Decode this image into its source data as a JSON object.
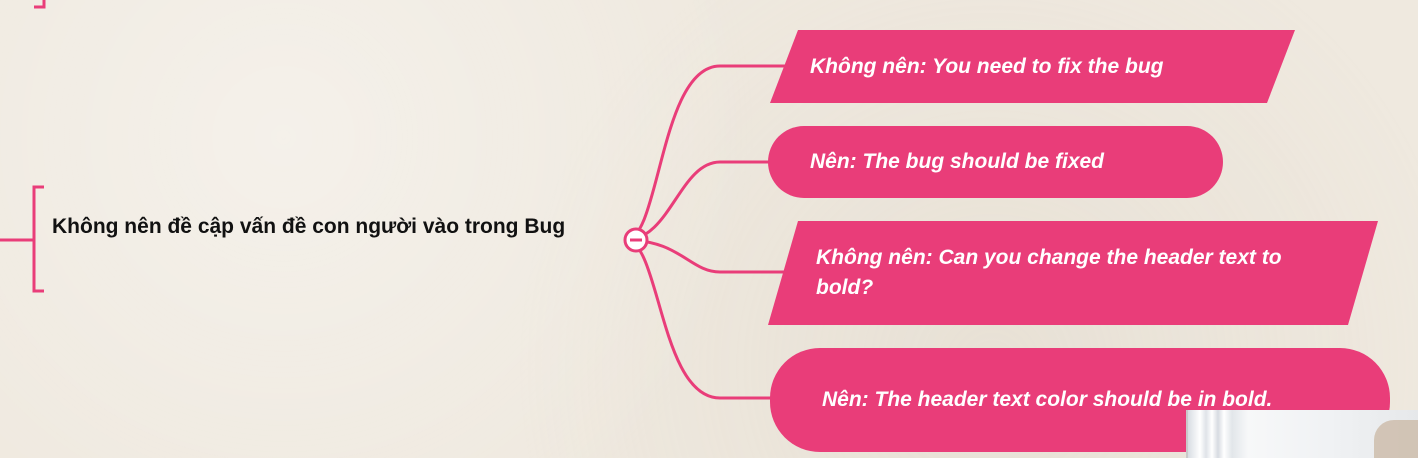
{
  "colors": {
    "accent": "#e93d79",
    "background": "#efe9df",
    "text": "#111111"
  },
  "main_topic": {
    "label": "Không nên đề cập vấn đề con người vào trong Bug"
  },
  "collapse_toggle": {
    "icon": "minus-circle-icon"
  },
  "children": [
    {
      "label": "Không nên: You need to fix the bug",
      "shape": "parallelogram"
    },
    {
      "label": "Nên: The bug should be fixed",
      "shape": "pill"
    },
    {
      "label": "Không nên: Can you change the header text to bold?",
      "shape": "parallelogram"
    },
    {
      "label": "Nên: The header text color should be in bold.",
      "shape": "pill"
    }
  ]
}
